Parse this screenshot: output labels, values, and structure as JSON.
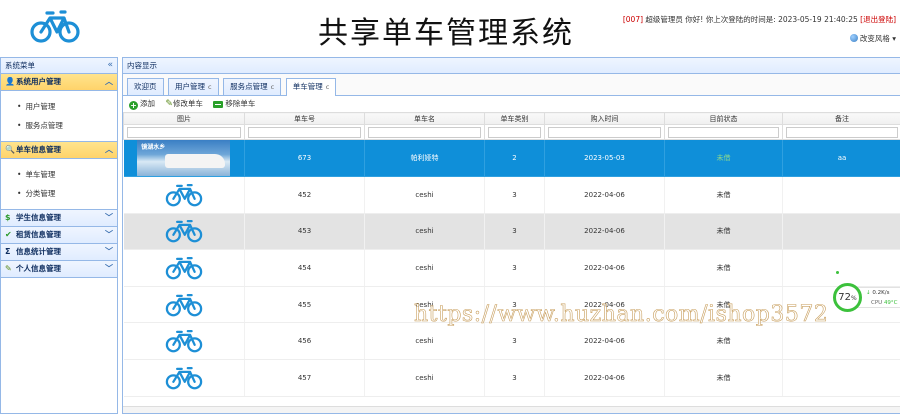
{
  "header": {
    "title": "共享单车管理系统",
    "user_id": "[007]",
    "user_text": " 超级管理员 你好! 你上次登陆的时间是: 2023-05-19 21:40:25 ",
    "logout": "[退出登陆]",
    "theme_label": "改变风格"
  },
  "sidebar": {
    "title": "系统菜单",
    "sections": [
      {
        "label": "系统用户管理",
        "icon": "user-icon",
        "items": [
          "用户管理",
          "服务点管理"
        ]
      },
      {
        "label": "单车信息管理",
        "icon": "magnifier-icon",
        "items": [
          "单车管理",
          "分类管理"
        ]
      },
      {
        "label": "学生信息管理",
        "icon": "dollar-icon"
      },
      {
        "label": "租赁信息管理",
        "icon": "check-icon"
      },
      {
        "label": "信息统计管理",
        "icon": "sigma-icon"
      },
      {
        "label": "个人信息管理",
        "icon": "pencil-icon"
      }
    ]
  },
  "main": {
    "title": "内容显示",
    "tabs": [
      "欢迎页",
      "用户管理",
      "服务点管理",
      "单车管理"
    ],
    "tab_close": "c",
    "toolbar": {
      "add": "添加",
      "edit": "修改单车",
      "delete": "移除单车"
    },
    "columns": [
      "图片",
      "单车号",
      "单车名",
      "单车类别",
      "购入时间",
      "目前状态",
      "备注"
    ],
    "rows": [
      {
        "no": "673",
        "name": "帕利娅特",
        "category": "2",
        "date": "2023-05-03",
        "status": "未借",
        "note": "aa",
        "image": "photo",
        "thumb_text": "镜湖水乡"
      },
      {
        "no": "452",
        "name": "ceshi",
        "category": "3",
        "date": "2022-04-06",
        "status": "未借",
        "note": "",
        "image": "bike"
      },
      {
        "no": "453",
        "name": "ceshi",
        "category": "3",
        "date": "2022-04-06",
        "status": "未借",
        "note": "",
        "image": "bike"
      },
      {
        "no": "454",
        "name": "ceshi",
        "category": "3",
        "date": "2022-04-06",
        "status": "未借",
        "note": "",
        "image": "bike"
      },
      {
        "no": "455",
        "name": "ceshi",
        "category": "3",
        "date": "2022-04-06",
        "status": "未借",
        "note": "",
        "image": "bike"
      },
      {
        "no": "456",
        "name": "ceshi",
        "category": "3",
        "date": "2022-04-06",
        "status": "未借",
        "note": "",
        "image": "bike"
      },
      {
        "no": "457",
        "name": "ceshi",
        "category": "3",
        "date": "2022-04-06",
        "status": "未借",
        "note": "",
        "image": "bike"
      }
    ]
  },
  "overlay": {
    "watermark": "https://www.huzhan.com/ishop3572",
    "cpu_percent": "72",
    "cpu_unit": "%",
    "net_speed": "0.2K/s",
    "cpu_label": "CPU",
    "cpu_temp": "49°C"
  },
  "colors": {
    "accent": "#0f8fd9",
    "bike": "#1d8fd6",
    "status": "#2c8f2c",
    "open_section": "#ffd36a"
  }
}
